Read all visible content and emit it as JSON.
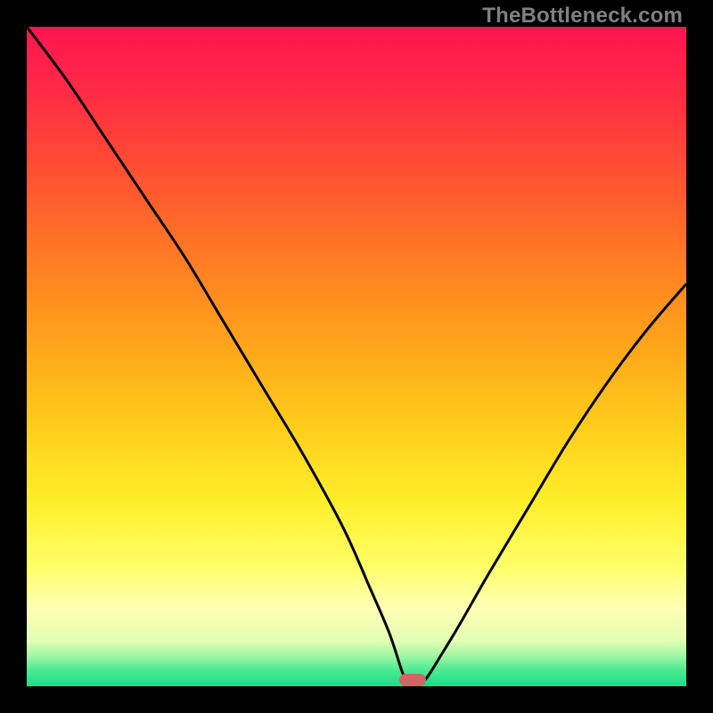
{
  "watermark": "TheBottleneck.com",
  "colors": {
    "marker": "#cd6764",
    "curve": "#000000",
    "frame": "#000000",
    "gradient_stops": [
      {
        "offset": 0.0,
        "color": "#ff1452"
      },
      {
        "offset": 0.1,
        "color": "#ff2b44"
      },
      {
        "offset": 0.2,
        "color": "#ff4a35"
      },
      {
        "offset": 0.3,
        "color": "#ff6a29"
      },
      {
        "offset": 0.4,
        "color": "#ff8b1f"
      },
      {
        "offset": 0.5,
        "color": "#ffab1a"
      },
      {
        "offset": 0.6,
        "color": "#ffcb1c"
      },
      {
        "offset": 0.72,
        "color": "#ffee2a"
      },
      {
        "offset": 0.82,
        "color": "#ffff6a"
      },
      {
        "offset": 0.88,
        "color": "#ffffb4"
      },
      {
        "offset": 0.93,
        "color": "#e4ffb4"
      },
      {
        "offset": 0.955,
        "color": "#9bf7a4"
      },
      {
        "offset": 0.975,
        "color": "#4de992"
      },
      {
        "offset": 1.0,
        "color": "#14e089"
      }
    ]
  },
  "chart_data": {
    "type": "line",
    "title": "",
    "xlabel": "",
    "ylabel": "",
    "xlim": [
      0,
      100
    ],
    "ylim": [
      0,
      100
    ],
    "grid": false,
    "series": [
      {
        "name": "bottleneck-curve",
        "x": [
          0,
          6,
          12,
          18,
          24,
          30,
          36,
          42,
          48,
          52,
          55,
          57,
          58,
          60,
          63,
          66,
          70,
          76,
          82,
          88,
          94,
          100
        ],
        "values": [
          100,
          92,
          83,
          74,
          65,
          55,
          45,
          35,
          24,
          15,
          8,
          2,
          0.5,
          0.5,
          5,
          10,
          17,
          27,
          37,
          46,
          54,
          61
        ]
      }
    ],
    "marker": {
      "x": 58.5,
      "y": 1.0
    }
  }
}
